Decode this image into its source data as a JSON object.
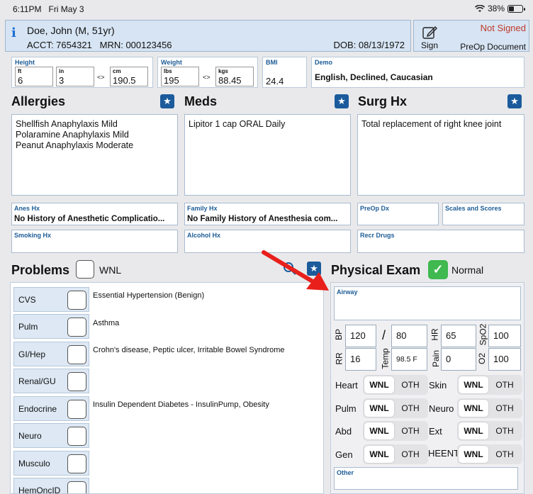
{
  "status_bar": {
    "time": "6:11PM",
    "date": "Fri May 3",
    "battery": "38%"
  },
  "patient": {
    "name": "Doe, John (M, 51yr)",
    "acct": "ACCT: 7654321",
    "mrn": "MRN: 000123456",
    "dob": "DOB: 08/13/1972"
  },
  "sign": {
    "label": "Sign",
    "status": "Not Signed",
    "document": "PreOp Document"
  },
  "height": {
    "label": "Height",
    "ft_label": "ft",
    "ft": "6",
    "in_label": "in",
    "in": "3",
    "cm_label": "cm",
    "cm": "190.5",
    "arrows": "<>"
  },
  "weight": {
    "label": "Weight",
    "lbs_label": "lbs",
    "lbs": "195",
    "kgs_label": "kgs",
    "kgs": "88.45",
    "arrows": "<>"
  },
  "bmi": {
    "label": "BMI",
    "value": "24.4"
  },
  "demo": {
    "label": "Demo",
    "value": "English, Declined, Caucasian"
  },
  "allergies": {
    "title": "Allergies",
    "items": [
      "Shellfish Anaphylaxis Mild",
      "Polaramine Anaphylaxis Mild",
      "Peanut Anaphylaxis Moderate"
    ]
  },
  "meds": {
    "title": "Meds",
    "items": [
      "Lipitor 1 cap ORAL Daily"
    ]
  },
  "surg": {
    "title": "Surg Hx",
    "items": [
      "Total replacement of right knee joint"
    ]
  },
  "anes_hx": {
    "label": "Anes Hx",
    "value": "No History of Anesthetic Complicatio..."
  },
  "family_hx": {
    "label": "Family Hx",
    "value": "No Family History of Anesthesia com..."
  },
  "preop_dx": {
    "label": "PreOp Dx",
    "value": ""
  },
  "scales": {
    "label": "Scales and Scores",
    "value": ""
  },
  "smoking_hx": {
    "label": "Smoking Hx",
    "value": ""
  },
  "alcohol_hx": {
    "label": "Alcohol Hx",
    "value": ""
  },
  "recr_drugs": {
    "label": "Recr Drugs",
    "value": ""
  },
  "problems": {
    "title": "Problems",
    "wnl": "WNL",
    "rows": [
      {
        "label": "CVS",
        "desc": "Essential Hypertension (Benign)"
      },
      {
        "label": "Pulm",
        "desc": "Asthma"
      },
      {
        "label": "GI/Hep",
        "desc": "Crohn's disease, Peptic ulcer, Irritable Bowel Syndrome"
      },
      {
        "label": "Renal/GU",
        "desc": ""
      },
      {
        "label": "Endocrine",
        "desc": "Insulin Dependent Diabetes - InsulinPump, Obesity"
      },
      {
        "label": "Neuro",
        "desc": ""
      },
      {
        "label": "Musculo",
        "desc": ""
      },
      {
        "label": "HemOncID",
        "desc": ""
      }
    ]
  },
  "physical_exam": {
    "title": "Physical Exam",
    "normal": "Normal",
    "airway_label": "Airway",
    "other_label": "Other",
    "vitals": {
      "bp_label": "BP",
      "bp_sys": "120",
      "slash": "/",
      "bp_dia": "80",
      "hr_label": "HR",
      "hr": "65",
      "spo2_label": "SpO2",
      "spo2": "100",
      "rr_label": "RR",
      "rr": "16",
      "temp_label": "Temp",
      "temp": "98.5 F",
      "pain_label": "Pain",
      "pain": "0",
      "o2_label": "O2",
      "o2": "100"
    },
    "systems": [
      {
        "label": "Heart",
        "wnl": "WNL",
        "oth": "OTH"
      },
      {
        "label": "Skin",
        "wnl": "WNL",
        "oth": "OTH"
      },
      {
        "label": "Pulm",
        "wnl": "WNL",
        "oth": "OTH"
      },
      {
        "label": "Neuro",
        "wnl": "WNL",
        "oth": "OTH"
      },
      {
        "label": "Abd",
        "wnl": "WNL",
        "oth": "OTH"
      },
      {
        "label": "Ext",
        "wnl": "WNL",
        "oth": "OTH"
      },
      {
        "label": "Gen",
        "wnl": "WNL",
        "oth": "OTH"
      },
      {
        "label": "HEENT",
        "wnl": "WNL",
        "oth": "OTH"
      }
    ]
  },
  "colors": {
    "accent": "#1b5b9c",
    "not_signed": "#c0392b",
    "normal_check": "#3fb950",
    "annotation_arrow": "#e8201c"
  },
  "icons": {
    "info": "info-icon",
    "sign": "pencil-square-icon",
    "star": "star-icon",
    "search": "search-icon",
    "check": "check-icon",
    "wifi": "wifi-icon",
    "battery": "battery-icon"
  }
}
